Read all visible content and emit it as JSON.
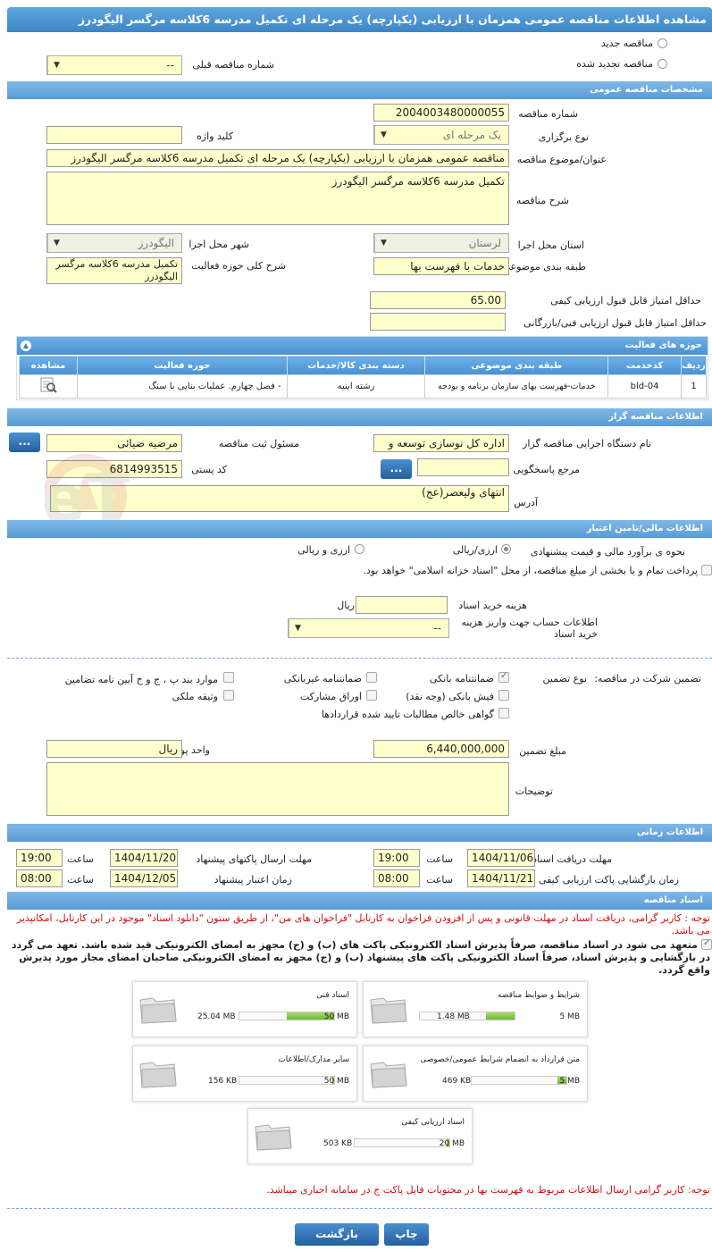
{
  "header": {
    "title": "مشاهده اطلاعات مناقصه عمومی همزمان با ارزیابی (یکپارچه) یک مرحله ای تکمیل مدرسه 6کلاسه مرگسر الیگودرز"
  },
  "top": {
    "new_label": "مناقصه جدید",
    "renewed_label": "مناقصه تجدید شده",
    "prev_number_label": "شماره مناقصه قبلی",
    "prev_number_value": "--"
  },
  "general": {
    "section": "مشخصات مناقصه عمومی",
    "number_label": "شماره مناقصه",
    "number_value": "2004003480000055",
    "type_label": "نوع برگزاری",
    "type_value": "یک مرحله ای",
    "keyword_label": "کلید واژه",
    "keyword_value": "",
    "subject_label": "عنوان/موضوع مناقصه",
    "subject_value": "مناقصه عمومی همزمان با ارزیابی (یکپارچه) یک مرحله ای تکمیل مدرسه 6کلاسه مرگسر الیگودرز",
    "desc_label": "شرح مناقصه",
    "desc_value": "تکمیل مدرسه 6کلاسه مرگسر الیگودرز",
    "province_label": "استان محل اجرا",
    "province_value": "لرستان",
    "city_label": "شهر محل اجرا",
    "city_value": "الیگودرز",
    "category_label": "طبقه بندی موضوعی",
    "category_value": "خدمات با فهرست بها",
    "scope_label": "شرح کلی حوزه فعالیت",
    "scope_value": "تکمیل مدرسه 6کلاسه مرگسر الیگودرز",
    "min_quality_label": "حداقل امتیاز قابل قبول ارزیابی کیفی",
    "min_quality_value": "65.00",
    "min_tech_label": "حداقل امتیاز قابل قبول ارزیابی فنی/بازرگانی",
    "min_tech_value": ""
  },
  "activities": {
    "title": "حوزه های فعالیت",
    "headers": [
      "ردیف",
      "کدخدمت",
      "طبقه بندی موضوعی",
      "دسته بندی کالا/خدمات",
      "حوزه فعالیت",
      "مشاهده"
    ],
    "rows": [
      {
        "idx": "1",
        "code": "bld-04",
        "category": "خدمات-فهرست بهای سازمان برنامه و بودجه",
        "group": "رشته ابنیه",
        "field": "- فصل چهارم. عملیات بنایی با سنگ"
      }
    ]
  },
  "org": {
    "section": "اطلاعات مناقصه گزار",
    "agency_label": "نام دستگاه اجرایی مناقصه گزار",
    "agency_value": "اداره کل نوسازی  توسعه و",
    "registrar_label": "مسئول ثبت مناقصه",
    "registrar_value": "مرضیه ضیائی",
    "ref_label": "مرجع پاسخگویی",
    "ref_value": "",
    "postal_label": "کد پستی",
    "postal_value": "6814993515",
    "address_label": "آدرس",
    "address_value": "انتهای ولیعصر(عج)",
    "btn": "..."
  },
  "finance": {
    "section": "اطلاعات مالی/تامین اعتبار",
    "estimate_label": "نحوه ی برآورد مالی و قیمت پیشنهادی",
    "opt_currency": "ارزی/ریالی",
    "opt_currency_rial": "ارزی و ریالی",
    "treasury_text": "پرداخت تمام و یا بخشی از مبلغ مناقصه، از محل \"اسناد خزانه اسلامی\" خواهد بود.",
    "doc_cost_label": "هزینه خرید اسناد",
    "doc_cost_unit": "ریال",
    "doc_cost_value": "",
    "account_label": "اطلاعات حساب جهت واریز هزینه خرید اسناد",
    "account_value": "--"
  },
  "guarantee": {
    "label": "تضمین شرکت در مناقصه:",
    "type_label": "نوع تضمین",
    "items": [
      "ضمانتنامه بانکی",
      "ضمانتنامه غیربانکی",
      "موارد بند پ ، ج و خ آیین نامه تضامین",
      "فیش بانکی (وجه نقد)",
      "اوراق مشارکت",
      "وثیقه ملکی",
      "گواهی خالص مطالبات تایید شده قراردادها"
    ],
    "amount_label": "مبلغ تضمین",
    "amount_value": "6,440,000,000",
    "unit_label": "واحد پول",
    "unit_value": "ریال",
    "notes_label": "توضیحات",
    "notes_value": ""
  },
  "timing": {
    "section": "اطلاعات زمانی",
    "receive_label": "مهلت دریافت اسناد",
    "receive_date": "1404/11/06",
    "receive_time": "19:00",
    "send_label": "مهلت ارسال پاکتهای پیشنهاد",
    "send_date": "1404/11/20",
    "send_time": "19:00",
    "open_label": "زمان بازگشایی پاکت ارزیابی کیفی",
    "open_date": "1404/11/21",
    "open_time": "08:00",
    "valid_label": "زمان اعتبار پیشنهاد",
    "valid_date": "1404/12/05",
    "valid_time": "08:00",
    "time_label": "ساعت"
  },
  "docs": {
    "section": "اسناد مناقصه",
    "note1": "توجه : کاربر گرامی، دریافت اسناد در مهلت قانونی و پس از افزودن فراخوان به کارتابل \"فراخوان های من\"، از طریق ستون \"دانلود اسناد\" موجود در این کارتابل، امکانپذیر می باشد.",
    "commit": "متعهد می شود در اسناد مناقصه، صرفاً پذیرش اسناد الکترونیکی پاکت های (ب) و (ج) مجهز به امضای الکترونیکی قید شده باشد. تعهد می گردد در بازگشایی و پذیرش اسناد، صرفاً اسناد الکترونیکی پاکت های پیشنهاد (ب) و (ج) مجهز به امضای الکترونیکی صاحبان امضای مجاز مورد پذیرش واقع گردد.",
    "files": [
      {
        "name": "شرایط و ضوابط مناقصه",
        "current": "1.48 MB",
        "max": "5 MB",
        "pct": 0.3
      },
      {
        "name": "اسناد فنی",
        "current": "25.04 MB",
        "max": "50 MB",
        "pct": 0.5
      },
      {
        "name": "متن قرارداد به انضمام شرایط عمومی/خصوصی",
        "current": "469 KB",
        "max": "5 MB",
        "pct": 0.09
      },
      {
        "name": "سایر مدارک/اطلاعات",
        "current": "156 KB",
        "max": "50 MB",
        "pct": 0.003
      },
      {
        "name": "اسناد ارزیابی کیفی",
        "current": "503 KB",
        "max": "20 MB",
        "pct": 0.025
      }
    ],
    "note2": "توجه: کاربر گرامی ارسال اطلاعات مربوط به فهرست بها در محتویات فایل پاکت ج در سامانه اجباری میباشد."
  },
  "buttons": {
    "back": "بازگشت",
    "print": "چاپ"
  },
  "watermark": "AriaTender.neT"
}
